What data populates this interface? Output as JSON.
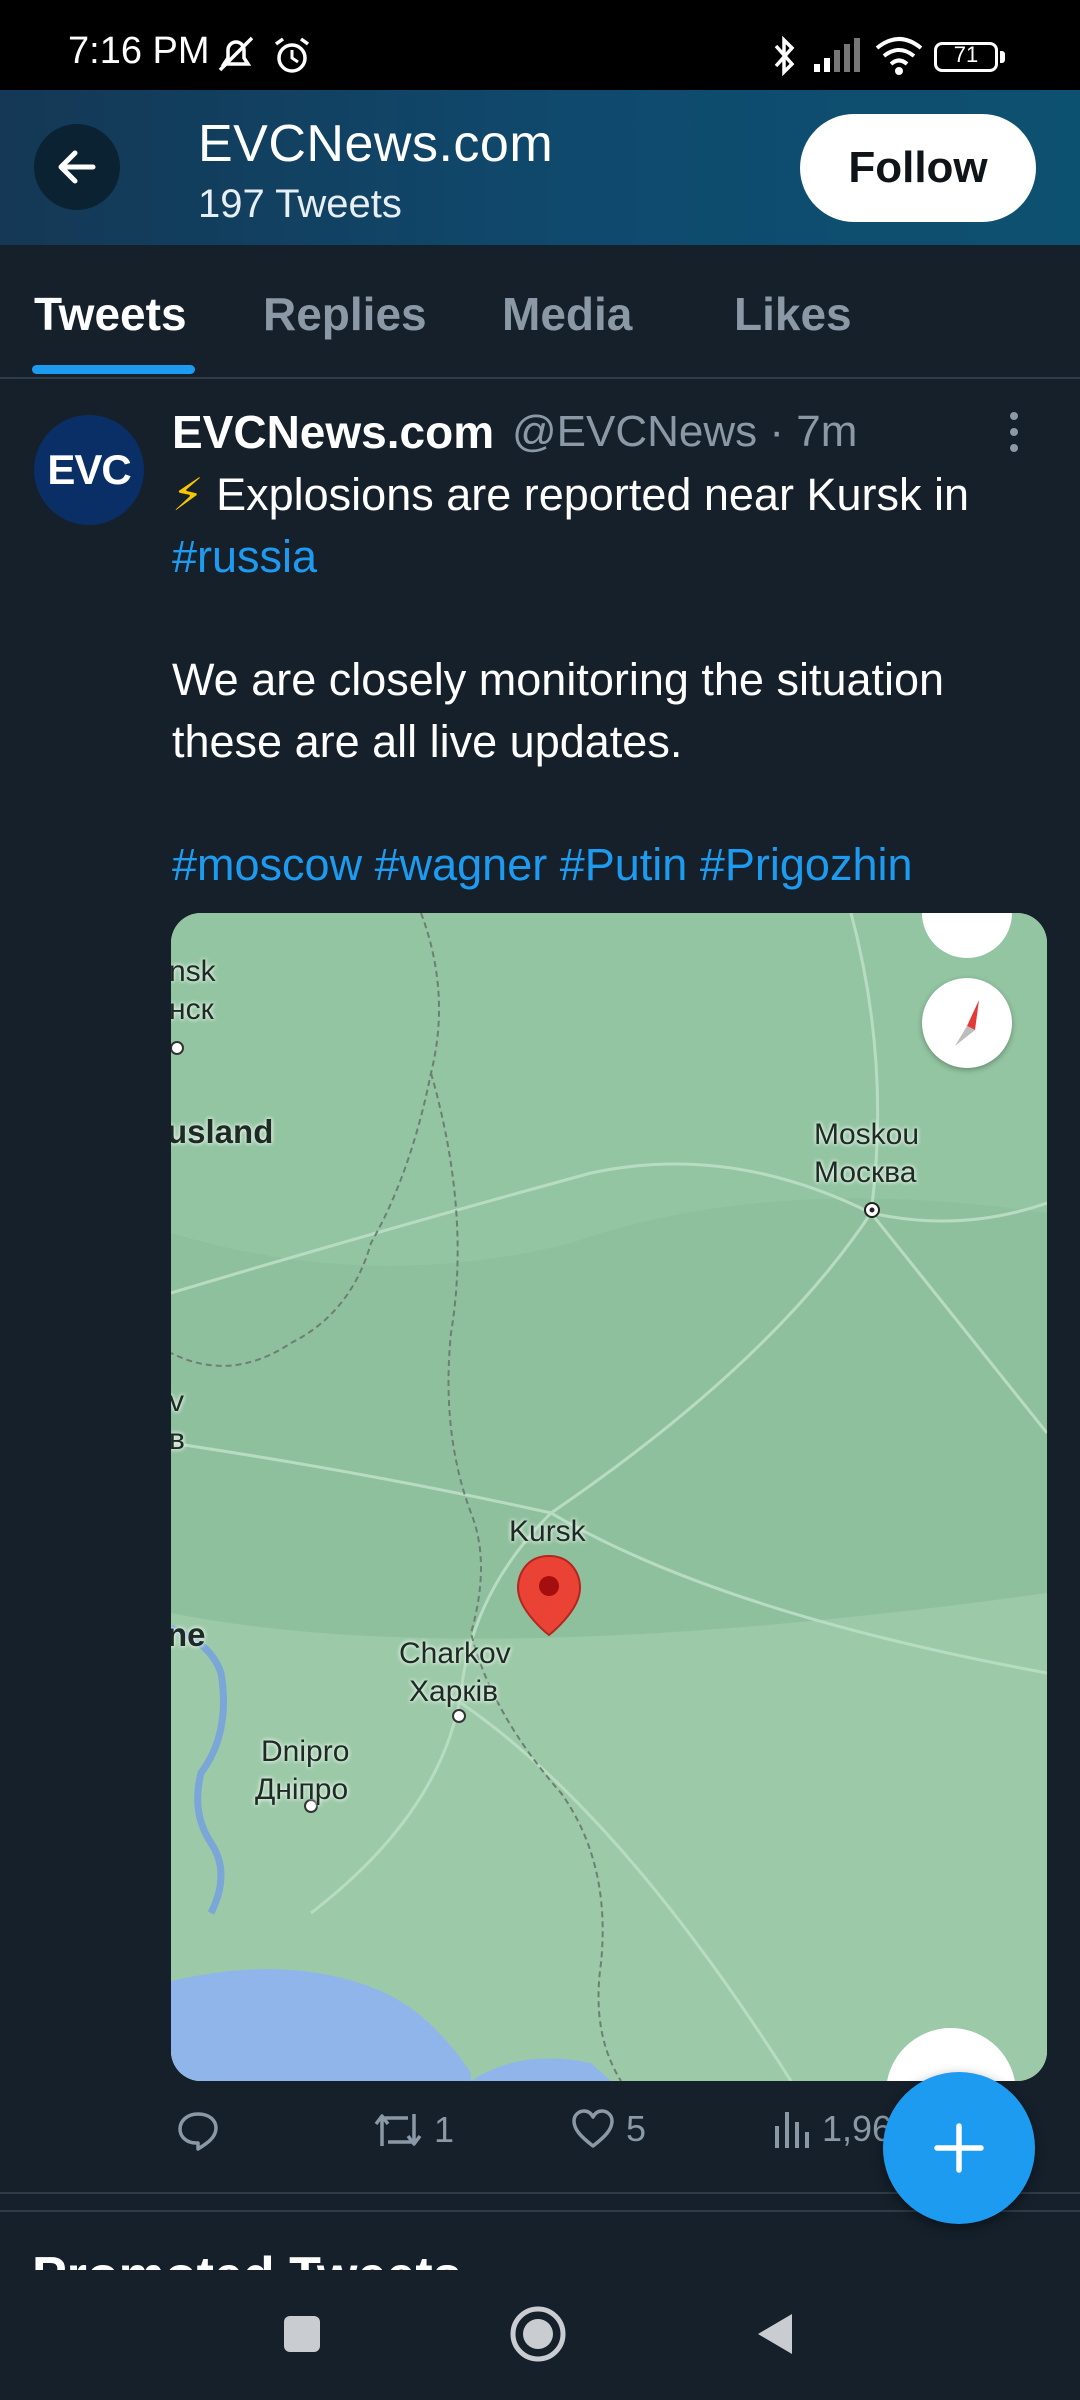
{
  "status_bar": {
    "time": "7:16 PM",
    "battery": "71"
  },
  "header": {
    "title": "EVCNews.com",
    "subtitle": "197 Tweets",
    "follow_label": "Follow"
  },
  "tabs": [
    {
      "label": "Tweets",
      "active": true
    },
    {
      "label": "Replies",
      "active": false
    },
    {
      "label": "Media",
      "active": false
    },
    {
      "label": "Likes",
      "active": false
    }
  ],
  "tweet": {
    "avatar_text": "EVC",
    "name": "EVCNews.com",
    "handle_time": "@EVCNews · 7m",
    "line1_emoji": "⚡",
    "line1_text": " Explosions are reported near Kursk in",
    "line2_hashtag": "#russia",
    "line3": "We are closely monitoring the situation",
    "line4": "these are all live updates.",
    "hashtags": [
      "#moscow",
      "#wagner",
      "#Putin",
      "#Prigozhin"
    ],
    "map_labels": {
      "nsk": "nsk",
      "nsk_cyr": "нск",
      "usland": "usland",
      "moskou": "Moskou",
      "moskva": "Москва",
      "v": "v",
      "v_cyr": "в",
      "kursk": "Kursk",
      "ne": "ne",
      "charkov": "Charkov",
      "kharkiv": "Харків",
      "dnipro": "Dnipro",
      "dnipro_cyr": "Дніпро"
    },
    "actions": {
      "replies": "",
      "retweets": "1",
      "likes": "5",
      "views": "1,96"
    }
  },
  "next_section_title": "Promoted Tweets",
  "colors": {
    "accent": "#1d9bf0",
    "background": "#15202b",
    "map_green": "#8ebf9e",
    "marker": "#ea4335"
  }
}
